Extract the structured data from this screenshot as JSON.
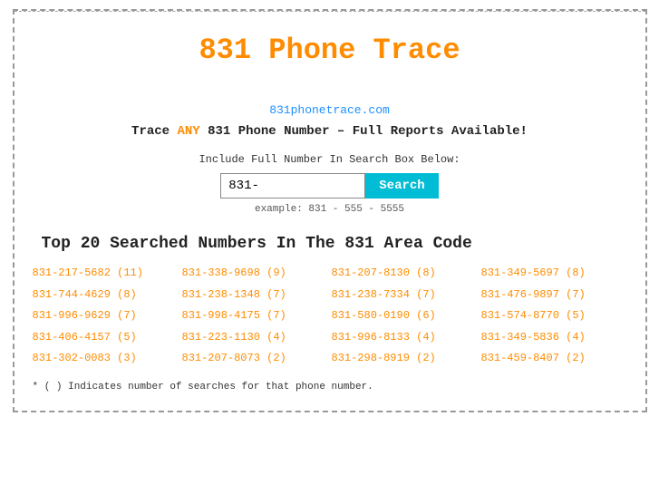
{
  "page": {
    "title": "831 Phone Trace",
    "site_url": "831phonetrace.com",
    "tagline_prefix": "Trace ",
    "tagline_any": "ANY",
    "tagline_suffix": " 831 Phone Number – Full Reports Available!",
    "search_label": "Include Full Number In Search Box Below:",
    "search_value": "831-",
    "search_placeholder": "831-",
    "search_button_label": "Search",
    "search_example": "example: 831 - 555 - 5555",
    "top20_title": "Top 20 Searched Numbers In The 831 Area Code",
    "footnote": "* ( ) Indicates number of searches for that phone number."
  },
  "numbers": [
    {
      "text": "831-217-5682 (11)"
    },
    {
      "text": "831-338-9698 (9)"
    },
    {
      "text": "831-207-8130 (8)"
    },
    {
      "text": "831-349-5697 (8)"
    },
    {
      "text": "831-744-4629 (8)"
    },
    {
      "text": "831-238-1348 (7)"
    },
    {
      "text": "831-238-7334 (7)"
    },
    {
      "text": "831-476-9897 (7)"
    },
    {
      "text": "831-996-9629 (7)"
    },
    {
      "text": "831-998-4175 (7)"
    },
    {
      "text": "831-580-0190 (6)"
    },
    {
      "text": "831-574-8770 (5)"
    },
    {
      "text": "831-406-4157 (5)"
    },
    {
      "text": "831-223-1130 (4)"
    },
    {
      "text": "831-996-8133 (4)"
    },
    {
      "text": "831-349-5836 (4)"
    },
    {
      "text": "831-302-0083 (3)"
    },
    {
      "text": "831-207-8073 (2)"
    },
    {
      "text": "831-298-8919 (2)"
    },
    {
      "text": "831-459-8407 (2)"
    }
  ]
}
